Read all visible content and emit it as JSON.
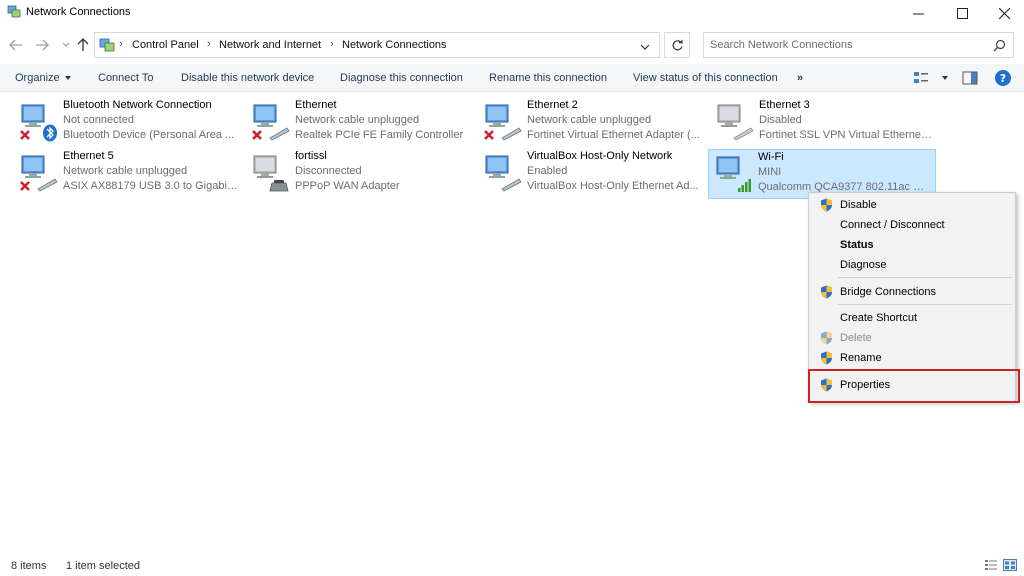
{
  "window": {
    "title": "Network Connections"
  },
  "address": {
    "crumbs": [
      "Control Panel",
      "Network and Internet",
      "Network Connections"
    ],
    "search_placeholder": "Search Network Connections"
  },
  "commands": {
    "organize": "Organize",
    "connect_to": "Connect To",
    "disable_device": "Disable this network device",
    "diagnose": "Diagnose this connection",
    "rename": "Rename this connection",
    "view_status": "View status of this connection",
    "more": "»"
  },
  "connections": [
    {
      "name": "Bluetooth Network Connection",
      "status": "Not connected",
      "device": "Bluetooth Device (Personal Area ...",
      "icon": "bluetooth-adapter-icon",
      "error": true
    },
    {
      "name": "Ethernet",
      "status": "Network cable unplugged",
      "device": "Realtek PCIe FE Family Controller",
      "icon": "ethernet-adapter-icon",
      "error": true
    },
    {
      "name": "Ethernet 2",
      "status": "Network cable unplugged",
      "device": "Fortinet Virtual Ethernet Adapter (...",
      "icon": "ethernet-adapter-icon",
      "error": true
    },
    {
      "name": "Ethernet 3",
      "status": "Disabled",
      "device": "Fortinet SSL VPN Virtual Ethernet ...",
      "icon": "ethernet-adapter-disabled-icon",
      "error": false
    },
    {
      "name": "Ethernet 5",
      "status": "Network cable unplugged",
      "device": "ASIX AX88179 USB 3.0 to Gigabit E...",
      "icon": "ethernet-adapter-icon",
      "error": true
    },
    {
      "name": "fortissl",
      "status": "Disconnected",
      "device": "PPPoP WAN Adapter",
      "icon": "dialup-adapter-icon",
      "error": false
    },
    {
      "name": "VirtualBox Host-Only Network",
      "status": "Enabled",
      "device": "VirtualBox Host-Only Ethernet Ad...",
      "icon": "ethernet-adapter-icon",
      "error": false
    },
    {
      "name": "Wi-Fi",
      "status": "MINI",
      "device": "Qualcomm QCA9377 802.11ac Wi...",
      "icon": "wifi-adapter-icon",
      "error": false
    }
  ],
  "context_menu": {
    "items": [
      "Disable",
      "Connect / Disconnect",
      "Status",
      "Diagnose",
      "Bridge Connections",
      "Create Shortcut",
      "Delete",
      "Rename",
      "Properties"
    ]
  },
  "status_bar": {
    "item_count": "8 items",
    "selection": "1 item selected"
  },
  "colors": {
    "selection_bg": "#cce8ff",
    "highlight_border": "#d0202a",
    "command_text": "#1e395b"
  }
}
